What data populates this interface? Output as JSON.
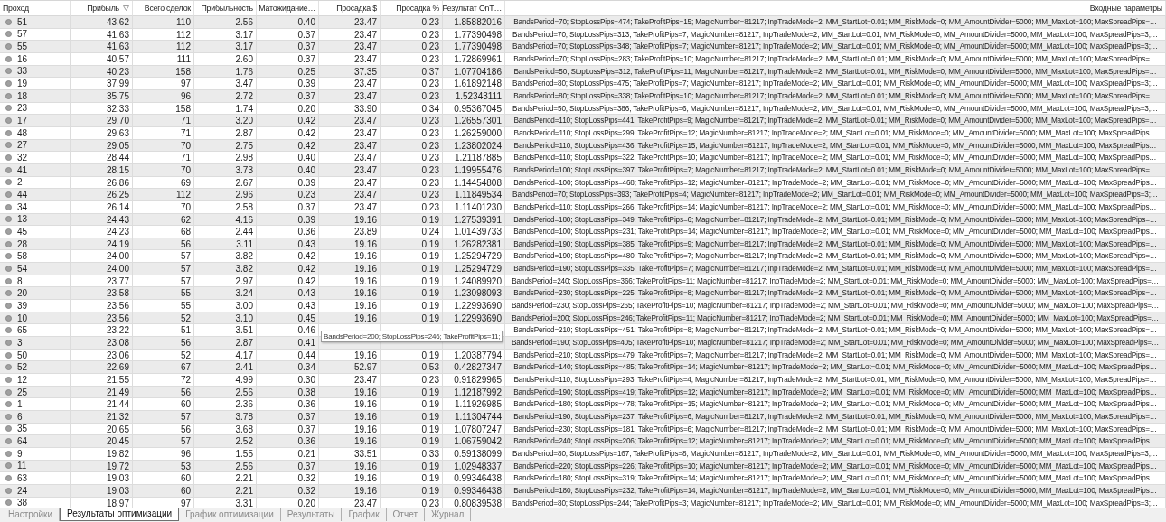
{
  "table": {
    "columns": [
      {
        "label": "Проход",
        "sorted": false
      },
      {
        "label": "Прибыль",
        "sorted": true
      },
      {
        "label": "Всего сделок",
        "sorted": false
      },
      {
        "label": "Прибыльность",
        "sorted": false
      },
      {
        "label": "Матожидание…",
        "sorted": false
      },
      {
        "label": "Просадка $",
        "sorted": false
      },
      {
        "label": "Просадка %",
        "sorted": false
      },
      {
        "label": "Результат OnT…",
        "sorted": false
      },
      {
        "label": "Входные параметры",
        "sorted": false
      }
    ],
    "rows": [
      {
        "pass": "51",
        "profit": "43.62",
        "trades": "110",
        "pf": "2.56",
        "payoff": "0.40",
        "dd": "23.47",
        "ddp": "0.23",
        "result": "1.85882016",
        "params": "BandsPeriod=70; StopLossPips=474; TakeProfitPips=15; MagicNumber=81217; InpTradeMode=2; MM_StartLot=0.01; MM_RiskMode=0; MM_AmountDivider=5000; MM_MaxLot=100; MaxSpreadPips=…"
      },
      {
        "pass": "57",
        "profit": "41.63",
        "trades": "112",
        "pf": "3.17",
        "payoff": "0.37",
        "dd": "23.47",
        "ddp": "0.23",
        "result": "1.77390498",
        "params": "BandsPeriod=70; StopLossPips=313; TakeProfitPips=7; MagicNumber=81217; InpTradeMode=2; MM_StartLot=0.01; MM_RiskMode=0; MM_AmountDivider=5000; MM_MaxLot=100; MaxSpreadPips=3;…"
      },
      {
        "pass": "55",
        "profit": "41.63",
        "trades": "112",
        "pf": "3.17",
        "payoff": "0.37",
        "dd": "23.47",
        "ddp": "0.23",
        "result": "1.77390498",
        "params": "BandsPeriod=70; StopLossPips=348; TakeProfitPips=7; MagicNumber=81217; InpTradeMode=2; MM_StartLot=0.01; MM_RiskMode=0; MM_AmountDivider=5000; MM_MaxLot=100; MaxSpreadPips=3;…"
      },
      {
        "pass": "16",
        "profit": "40.57",
        "trades": "111",
        "pf": "2.60",
        "payoff": "0.37",
        "dd": "23.47",
        "ddp": "0.23",
        "result": "1.72869961",
        "params": "BandsPeriod=70; StopLossPips=283; TakeProfitPips=10; MagicNumber=81217; InpTradeMode=2; MM_StartLot=0.01; MM_RiskMode=0; MM_AmountDivider=5000; MM_MaxLot=100; MaxSpreadPips=…"
      },
      {
        "pass": "33",
        "profit": "40.23",
        "trades": "158",
        "pf": "1.76",
        "payoff": "0.25",
        "dd": "37.35",
        "ddp": "0.37",
        "result": "1.07704186",
        "params": "BandsPeriod=50; StopLossPips=312; TakeProfitPips=11; MagicNumber=81217; InpTradeMode=2; MM_StartLot=0.01; MM_RiskMode=0; MM_AmountDivider=5000; MM_MaxLot=100; MaxSpreadPips=…"
      },
      {
        "pass": "19",
        "profit": "37.99",
        "trades": "97",
        "pf": "3.47",
        "payoff": "0.39",
        "dd": "23.47",
        "ddp": "0.23",
        "result": "1.61892148",
        "params": "BandsPeriod=80; StopLossPips=475; TakeProfitPips=7; MagicNumber=81217; InpTradeMode=2; MM_StartLot=0.01; MM_RiskMode=0; MM_AmountDivider=5000; MM_MaxLot=100; MaxSpreadPips=3;…"
      },
      {
        "pass": "18",
        "profit": "35.75",
        "trades": "96",
        "pf": "2.72",
        "payoff": "0.37",
        "dd": "23.47",
        "ddp": "0.23",
        "result": "1.52343111",
        "params": "BandsPeriod=80; StopLossPips=338; TakeProfitPips=10; MagicNumber=81217; InpTradeMode=2; MM_StartLot=0.01; MM_RiskMode=0; MM_AmountDivider=5000; MM_MaxLot=100; MaxSpreadPips=…"
      },
      {
        "pass": "23",
        "profit": "32.33",
        "trades": "158",
        "pf": "1.74",
        "payoff": "0.20",
        "dd": "33.90",
        "ddp": "0.34",
        "result": "0.95367045",
        "params": "BandsPeriod=50; StopLossPips=386; TakeProfitPips=6; MagicNumber=81217; InpTradeMode=2; MM_StartLot=0.01; MM_RiskMode=0; MM_AmountDivider=5000; MM_MaxLot=100; MaxSpreadPips=3;…"
      },
      {
        "pass": "17",
        "profit": "29.70",
        "trades": "71",
        "pf": "3.20",
        "payoff": "0.42",
        "dd": "23.47",
        "ddp": "0.23",
        "result": "1.26557301",
        "params": "BandsPeriod=110; StopLossPips=441; TakeProfitPips=9; MagicNumber=81217; InpTradeMode=2; MM_StartLot=0.01; MM_RiskMode=0; MM_AmountDivider=5000; MM_MaxLot=100; MaxSpreadPips=…"
      },
      {
        "pass": "48",
        "profit": "29.63",
        "trades": "71",
        "pf": "2.87",
        "payoff": "0.42",
        "dd": "23.47",
        "ddp": "0.23",
        "result": "1.26259000",
        "params": "BandsPeriod=110; StopLossPips=299; TakeProfitPips=12; MagicNumber=81217; InpTradeMode=2; MM_StartLot=0.01; MM_RiskMode=0; MM_AmountDivider=5000; MM_MaxLot=100; MaxSpreadPips…"
      },
      {
        "pass": "27",
        "profit": "29.05",
        "trades": "70",
        "pf": "2.75",
        "payoff": "0.42",
        "dd": "23.47",
        "ddp": "0.23",
        "result": "1.23802024",
        "params": "BandsPeriod=110; StopLossPips=436; TakeProfitPips=15; MagicNumber=81217; InpTradeMode=2; MM_StartLot=0.01; MM_RiskMode=0; MM_AmountDivider=5000; MM_MaxLot=100; MaxSpreadPips…"
      },
      {
        "pass": "32",
        "profit": "28.44",
        "trades": "71",
        "pf": "2.98",
        "payoff": "0.40",
        "dd": "23.47",
        "ddp": "0.23",
        "result": "1.21187885",
        "params": "BandsPeriod=110; StopLossPips=322; TakeProfitPips=10; MagicNumber=81217; InpTradeMode=2; MM_StartLot=0.01; MM_RiskMode=0; MM_AmountDivider=5000; MM_MaxLot=100; MaxSpreadPips…"
      },
      {
        "pass": "41",
        "profit": "28.15",
        "trades": "70",
        "pf": "3.73",
        "payoff": "0.40",
        "dd": "23.47",
        "ddp": "0.23",
        "result": "1.19955476",
        "params": "BandsPeriod=100; StopLossPips=397; TakeProfitPips=7; MagicNumber=81217; InpTradeMode=2; MM_StartLot=0.01; MM_RiskMode=0; MM_AmountDivider=5000; MM_MaxLot=100; MaxSpreadPips=…"
      },
      {
        "pass": "2",
        "profit": "26.86",
        "trades": "69",
        "pf": "2.67",
        "payoff": "0.39",
        "dd": "23.47",
        "ddp": "0.23",
        "result": "1.14454808",
        "params": "BandsPeriod=100; StopLossPips=468; TakeProfitPips=12; MagicNumber=81217; InpTradeMode=2; MM_StartLot=0.01; MM_RiskMode=0; MM_AmountDivider=5000; MM_MaxLot=100; MaxSpreadPips…"
      },
      {
        "pass": "44",
        "profit": "26.25",
        "trades": "112",
        "pf": "2.96",
        "payoff": "0.23",
        "dd": "23.47",
        "ddp": "0.23",
        "result": "1.11849534",
        "params": "BandsPeriod=70; StopLossPips=393; TakeProfitPips=4; MagicNumber=81217; InpTradeMode=2; MM_StartLot=0.01; MM_RiskMode=0; MM_AmountDivider=5000; MM_MaxLot=100; MaxSpreadPips=3;…"
      },
      {
        "pass": "34",
        "profit": "26.14",
        "trades": "70",
        "pf": "2.58",
        "payoff": "0.37",
        "dd": "23.47",
        "ddp": "0.23",
        "result": "1.11401230",
        "params": "BandsPeriod=110; StopLossPips=266; TakeProfitPips=14; MagicNumber=81217; InpTradeMode=2; MM_StartLot=0.01; MM_RiskMode=0; MM_AmountDivider=5000; MM_MaxLot=100; MaxSpreadPips…"
      },
      {
        "pass": "13",
        "profit": "24.43",
        "trades": "62",
        "pf": "4.16",
        "payoff": "0.39",
        "dd": "19.16",
        "ddp": "0.19",
        "result": "1.27539391",
        "params": "BandsPeriod=180; StopLossPips=349; TakeProfitPips=6; MagicNumber=81217; InpTradeMode=2; MM_StartLot=0.01; MM_RiskMode=0; MM_AmountDivider=5000; MM_MaxLot=100; MaxSpreadPips=…"
      },
      {
        "pass": "45",
        "profit": "24.23",
        "trades": "68",
        "pf": "2.44",
        "payoff": "0.36",
        "dd": "23.89",
        "ddp": "0.24",
        "result": "1.01439733",
        "params": "BandsPeriod=100; StopLossPips=231; TakeProfitPips=14; MagicNumber=81217; InpTradeMode=2; MM_StartLot=0.01; MM_RiskMode=0; MM_AmountDivider=5000; MM_MaxLot=100; MaxSpreadPips…"
      },
      {
        "pass": "28",
        "profit": "24.19",
        "trades": "56",
        "pf": "3.11",
        "payoff": "0.43",
        "dd": "19.16",
        "ddp": "0.19",
        "result": "1.26282381",
        "params": "BandsPeriod=190; StopLossPips=385; TakeProfitPips=9; MagicNumber=81217; InpTradeMode=2; MM_StartLot=0.01; MM_RiskMode=0; MM_AmountDivider=5000; MM_MaxLot=100; MaxSpreadPips=…"
      },
      {
        "pass": "58",
        "profit": "24.00",
        "trades": "57",
        "pf": "3.82",
        "payoff": "0.42",
        "dd": "19.16",
        "ddp": "0.19",
        "result": "1.25294729",
        "params": "BandsPeriod=190; StopLossPips=480; TakeProfitPips=7; MagicNumber=81217; InpTradeMode=2; MM_StartLot=0.01; MM_RiskMode=0; MM_AmountDivider=5000; MM_MaxLot=100; MaxSpreadPips=…"
      },
      {
        "pass": "54",
        "profit": "24.00",
        "trades": "57",
        "pf": "3.82",
        "payoff": "0.42",
        "dd": "19.16",
        "ddp": "0.19",
        "result": "1.25294729",
        "params": "BandsPeriod=190; StopLossPips=335; TakeProfitPips=7; MagicNumber=81217; InpTradeMode=2; MM_StartLot=0.01; MM_RiskMode=0; MM_AmountDivider=5000; MM_MaxLot=100; MaxSpreadPips=…"
      },
      {
        "pass": "8",
        "profit": "23.77",
        "trades": "57",
        "pf": "2.97",
        "payoff": "0.42",
        "dd": "19.16",
        "ddp": "0.19",
        "result": "1.24089920",
        "params": "BandsPeriod=240; StopLossPips=366; TakeProfitPips=11; MagicNumber=81217; InpTradeMode=2; MM_StartLot=0.01; MM_RiskMode=0; MM_AmountDivider=5000; MM_MaxLot=100; MaxSpreadPips=…"
      },
      {
        "pass": "20",
        "profit": "23.58",
        "trades": "55",
        "pf": "3.24",
        "payoff": "0.43",
        "dd": "19.16",
        "ddp": "0.19",
        "result": "1.23098093",
        "params": "BandsPeriod=230; StopLossPips=225; TakeProfitPips=8; MagicNumber=81217; InpTradeMode=2; MM_StartLot=0.01; MM_RiskMode=0; MM_AmountDivider=5000; MM_MaxLot=100; MaxSpreadPips=…"
      },
      {
        "pass": "39",
        "profit": "23.56",
        "trades": "55",
        "pf": "3.00",
        "payoff": "0.43",
        "dd": "19.16",
        "ddp": "0.19",
        "result": "1.22993690",
        "params": "BandsPeriod=230; StopLossPips=265; TakeProfitPips=10; MagicNumber=81217; InpTradeMode=2; MM_StartLot=0.01; MM_RiskMode=0; MM_AmountDivider=5000; MM_MaxLot=100; MaxSpreadPips=…"
      },
      {
        "pass": "10",
        "profit": "23.56",
        "trades": "52",
        "pf": "3.10",
        "payoff": "0.45",
        "dd": "19.16",
        "ddp": "0.19",
        "result": "1.22993690",
        "params": "BandsPeriod=200; StopLossPips=246; TakeProfitPips=11; MagicNumber=81217; InpTradeMode=2; MM_StartLot=0.01; MM_RiskMode=0; MM_AmountDivider=5000; MM_MaxLot=100; MaxSpreadPips=…"
      },
      {
        "pass": "65",
        "profit": "23.22",
        "trades": "51",
        "pf": "3.51",
        "payoff": "0.46",
        "params": "BandsPeriod=210; StopLossPips=451; TakeProfitPips=8; MagicNumber=81217; InpTradeMode=2; MM_StartLot=0.01; MM_RiskMode=0; MM_AmountDivider=5000; MM_MaxLot=100; MaxSpreadPips=…"
      },
      {
        "pass": "3",
        "profit": "23.08",
        "trades": "56",
        "pf": "2.87",
        "payoff": "0.41",
        "params": "BandsPeriod=190; StopLossPips=405; TakeProfitPips=10; MagicNumber=81217; InpTradeMode=2; MM_StartLot=0.01; MM_RiskMode=0; MM_AmountDivider=5000; MM_MaxLot=100; MaxSpreadPips=…"
      },
      {
        "pass": "50",
        "profit": "23.06",
        "trades": "52",
        "pf": "4.17",
        "payoff": "0.44",
        "dd": "19.16",
        "ddp": "0.19",
        "result": "1.20387794",
        "params": "BandsPeriod=210; StopLossPips=479; TakeProfitPips=7; MagicNumber=81217; InpTradeMode=2; MM_StartLot=0.01; MM_RiskMode=0; MM_AmountDivider=5000; MM_MaxLot=100; MaxSpreadPips=…"
      },
      {
        "pass": "52",
        "profit": "22.69",
        "trades": "67",
        "pf": "2.41",
        "payoff": "0.34",
        "dd": "52.97",
        "ddp": "0.53",
        "result": "0.42827347",
        "params": "BandsPeriod=140; StopLossPips=485; TakeProfitPips=14; MagicNumber=81217; InpTradeMode=2; MM_StartLot=0.01; MM_RiskMode=0; MM_AmountDivider=5000; MM_MaxLot=100; MaxSpreadPips…"
      },
      {
        "pass": "12",
        "profit": "21.55",
        "trades": "72",
        "pf": "4.99",
        "payoff": "0.30",
        "dd": "23.47",
        "ddp": "0.23",
        "result": "0.91829965",
        "params": "BandsPeriod=110; StopLossPips=293; TakeProfitPips=4; MagicNumber=81217; InpTradeMode=2; MM_StartLot=0.01; MM_RiskMode=0; MM_AmountDivider=5000; MM_MaxLot=100; MaxSpreadPips=…"
      },
      {
        "pass": "25",
        "profit": "21.49",
        "trades": "56",
        "pf": "2.56",
        "payoff": "0.38",
        "dd": "19.16",
        "ddp": "0.19",
        "result": "1.12187992",
        "params": "BandsPeriod=190; StopLossPips=419; TakeProfitPips=12; MagicNumber=81217; InpTradeMode=2; MM_StartLot=0.01; MM_RiskMode=0; MM_AmountDivider=5000; MM_MaxLot=100; MaxSpreadPips…"
      },
      {
        "pass": "1",
        "profit": "21.44",
        "trades": "60",
        "pf": "2.36",
        "payoff": "0.36",
        "dd": "19.16",
        "ddp": "0.19",
        "result": "1.11926985",
        "params": "BandsPeriod=180; StopLossPips=478; TakeProfitPips=15; MagicNumber=81217; InpTradeMode=2; MM_StartLot=0.01; MM_RiskMode=0; MM_AmountDivider=5000; MM_MaxLot=100; MaxSpreadPips…"
      },
      {
        "pass": "6",
        "profit": "21.32",
        "trades": "57",
        "pf": "3.78",
        "payoff": "0.37",
        "dd": "19.16",
        "ddp": "0.19",
        "result": "1.11304744",
        "params": "BandsPeriod=190; StopLossPips=237; TakeProfitPips=6; MagicNumber=81217; InpTradeMode=2; MM_StartLot=0.01; MM_RiskMode=0; MM_AmountDivider=5000; MM_MaxLot=100; MaxSpreadPips=…"
      },
      {
        "pass": "35",
        "profit": "20.65",
        "trades": "56",
        "pf": "3.68",
        "payoff": "0.37",
        "dd": "19.16",
        "ddp": "0.19",
        "result": "1.07807247",
        "params": "BandsPeriod=230; StopLossPips=181; TakeProfitPips=6; MagicNumber=81217; InpTradeMode=2; MM_StartLot=0.01; MM_RiskMode=0; MM_AmountDivider=5000; MM_MaxLot=100; MaxSpreadPips=…"
      },
      {
        "pass": "64",
        "profit": "20.45",
        "trades": "57",
        "pf": "2.52",
        "payoff": "0.36",
        "dd": "19.16",
        "ddp": "0.19",
        "result": "1.06759042",
        "params": "BandsPeriod=240; StopLossPips=206; TakeProfitPips=12; MagicNumber=81217; InpTradeMode=2; MM_StartLot=0.01; MM_RiskMode=0; MM_AmountDivider=5000; MM_MaxLot=100; MaxSpreadPips…"
      },
      {
        "pass": "9",
        "profit": "19.82",
        "trades": "96",
        "pf": "1.55",
        "payoff": "0.21",
        "dd": "33.51",
        "ddp": "0.33",
        "result": "0.59138099",
        "params": "BandsPeriod=80; StopLossPips=167; TakeProfitPips=8; MagicNumber=81217; InpTradeMode=2; MM_StartLot=0.01; MM_RiskMode=0; MM_AmountDivider=5000; MM_MaxLot=100; MaxSpreadPips=3;…"
      },
      {
        "pass": "11",
        "profit": "19.72",
        "trades": "53",
        "pf": "2.56",
        "payoff": "0.37",
        "dd": "19.16",
        "ddp": "0.19",
        "result": "1.02948337",
        "params": "BandsPeriod=220; StopLossPips=226; TakeProfitPips=10; MagicNumber=81217; InpTradeMode=2; MM_StartLot=0.01; MM_RiskMode=0; MM_AmountDivider=5000; MM_MaxLot=100; MaxSpreadPips…"
      },
      {
        "pass": "63",
        "profit": "19.03",
        "trades": "60",
        "pf": "2.21",
        "payoff": "0.32",
        "dd": "19.16",
        "ddp": "0.19",
        "result": "0.99346438",
        "params": "BandsPeriod=180; StopLossPips=319; TakeProfitPips=14; MagicNumber=81217; InpTradeMode=2; MM_StartLot=0.01; MM_RiskMode=0; MM_AmountDivider=5000; MM_MaxLot=100; MaxSpreadPips…"
      },
      {
        "pass": "24",
        "profit": "19.03",
        "trades": "60",
        "pf": "2.21",
        "payoff": "0.32",
        "dd": "19.16",
        "ddp": "0.19",
        "result": "0.99346438",
        "params": "BandsPeriod=180; StopLossPips=232; TakeProfitPips=14; MagicNumber=81217; InpTradeMode=2; MM_StartLot=0.01; MM_RiskMode=0; MM_AmountDivider=5000; MM_MaxLot=100; MaxSpreadPips…"
      },
      {
        "pass": "38",
        "profit": "18.97",
        "trades": "97",
        "pf": "3.31",
        "payoff": "0.20",
        "dd": "23.47",
        "ddp": "0.23",
        "result": "0.80839538",
        "params": "BandsPeriod=80; StopLossPips=244; TakeProfitPips=3; MagicNumber=81217; InpTradeMode=2; MM_StartLot=0.01; MM_RiskMode=0; MM_AmountDivider=5000; MM_MaxLot=100; MaxSpreadPips=3;…"
      }
    ]
  },
  "tooltip": {
    "text": "BandsPeriod=200; StopLossPips=246; TakeProfitPips=11;"
  },
  "tabs": [
    {
      "label": "Настройки",
      "selected": false
    },
    {
      "label": "Результаты оптимизации",
      "selected": true
    },
    {
      "label": "График оптимизации",
      "selected": false
    },
    {
      "label": "Результаты",
      "selected": false
    },
    {
      "label": "График",
      "selected": false
    },
    {
      "label": "Отчет",
      "selected": false
    },
    {
      "label": "Журнал",
      "selected": false
    }
  ]
}
